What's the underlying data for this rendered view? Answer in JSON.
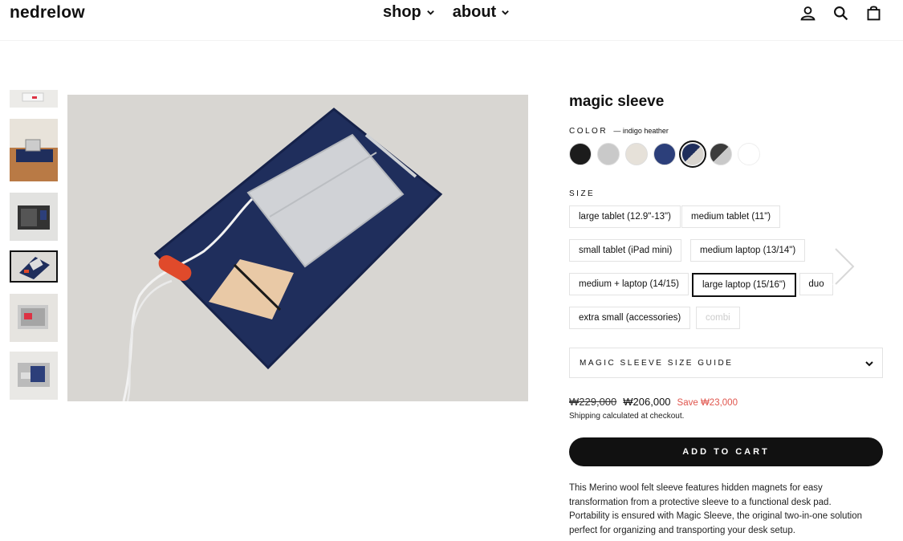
{
  "header": {
    "logo": "nedrelow",
    "nav": [
      {
        "label": "shop"
      },
      {
        "label": "about"
      }
    ],
    "icons": [
      "account-icon",
      "search-icon",
      "cart-icon"
    ]
  },
  "product": {
    "title": "magic sleeve",
    "color_label": "COLOR",
    "color_value": "— indigo heather",
    "swatches": [
      {
        "name": "black",
        "color": "#1c1c1c"
      },
      {
        "name": "light gray",
        "color": "#c9c9c9"
      },
      {
        "name": "oatmeal",
        "color": "#e6e1d9"
      },
      {
        "name": "navy",
        "color": "#2c3f7a"
      },
      {
        "name": "indigo heather",
        "color": "#1f2e5c",
        "selected": true
      },
      {
        "name": "charcoal gray",
        "color": "#3b3b3b"
      },
      {
        "name": "white",
        "color": "#ffffff"
      }
    ],
    "size_label": "SIZE",
    "sizes": [
      {
        "label": "large tablet (12.9\"-13\")"
      },
      {
        "label": "medium tablet (11\")"
      },
      {
        "label": "small tablet (iPad mini)"
      },
      {
        "label": "medium laptop (13/14\")"
      },
      {
        "label": "medium + laptop (14/15)"
      },
      {
        "label": "large laptop (15/16\")",
        "selected": true
      },
      {
        "label": "duo"
      },
      {
        "label": "extra small (accessories)"
      },
      {
        "label": "combi",
        "disabled": true
      }
    ],
    "size_guide": "MAGIC SLEEVE SIZE GUIDE",
    "price_original": "₩229,000",
    "price_sale": "₩206,000",
    "price_save": "Save ₩23,000",
    "shipping": "Shipping calculated at checkout.",
    "add_to_cart": "ADD TO CART",
    "description": "This Merino wool felt sleeve features hidden magnets for easy transformation from a protective sleeve to a functional desk pad. Portability is ensured with Magic Sleeve, the original two-in-one solution perfect for organizing and transporting your desk setup."
  },
  "colors": {
    "accent": "#111111",
    "sale": "#e0554d",
    "felt_navy": "#1f2e5c",
    "background_felt": "#d8d6d2"
  }
}
